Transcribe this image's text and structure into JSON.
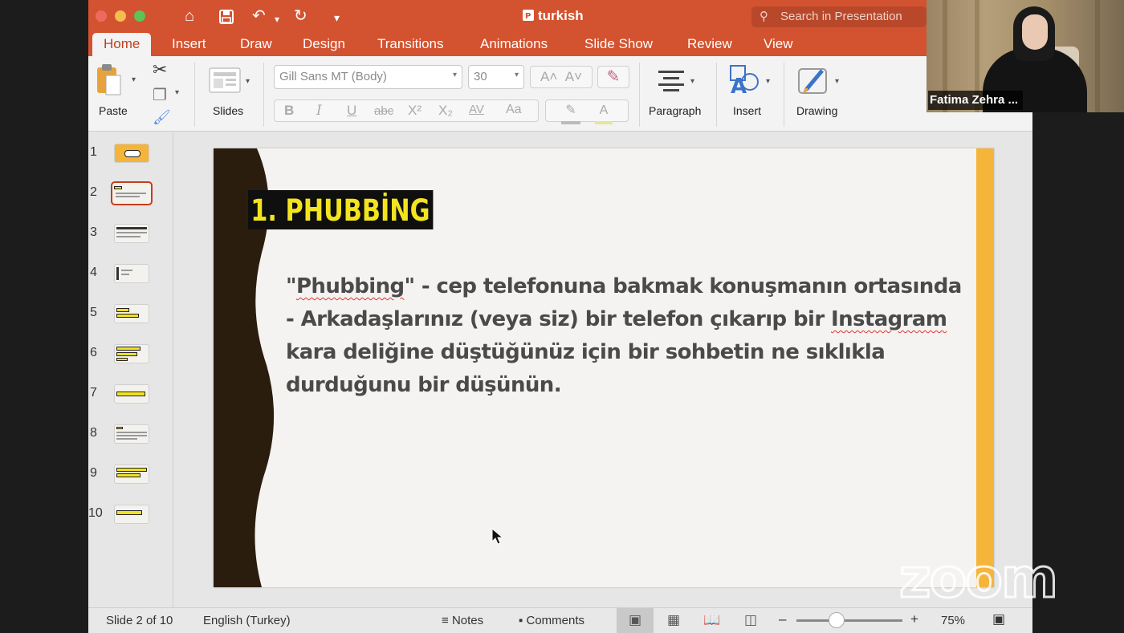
{
  "window": {
    "title": "turkish",
    "search_placeholder": "Search in Presentation"
  },
  "tabs": [
    {
      "label": "Home",
      "active": true
    },
    {
      "label": "Insert"
    },
    {
      "label": "Draw"
    },
    {
      "label": "Design"
    },
    {
      "label": "Transitions"
    },
    {
      "label": "Animations"
    },
    {
      "label": "Slide Show"
    },
    {
      "label": "Review"
    },
    {
      "label": "View"
    }
  ],
  "ribbon": {
    "paste_label": "Paste",
    "slides_label": "Slides",
    "font_name": "Gill Sans MT (Body)",
    "font_size": "30",
    "paragraph_label": "Paragraph",
    "insert_label": "Insert",
    "drawing_label": "Drawing",
    "grow_font": "A˄",
    "shrink_font": "A˅",
    "bold": "B",
    "italic": "I",
    "underline": "U",
    "strike": "abc",
    "superscript": "X²",
    "subscript": "X₂",
    "spacing": "AV",
    "change_case": "Aa"
  },
  "thumbnails": [
    "1",
    "2",
    "3",
    "4",
    "5",
    "6",
    "7",
    "8",
    "9",
    "10"
  ],
  "selected_slide": 2,
  "slide": {
    "title": "1. PHUBBİNG",
    "body_parts": {
      "q1": "\"",
      "w1": "Phubbing",
      "t1": "\" - cep telefonuna bakmak konuşmanın ortasında - Arkadaşlarınız (veya siz) bir telefon çıkarıp bir ",
      "w2": "Instagram",
      "t2": " kara deliğine düştüğünüz için bir sohbetin ne sıklıkla durduğunu bir düşünün."
    }
  },
  "status": {
    "slide_info": "Slide 2 of 10",
    "language": "English (Turkey)",
    "notes": "Notes",
    "comments": "Comments",
    "zoom": "75%"
  },
  "video": {
    "participant": "Fatima Zehra ..."
  },
  "overlay": {
    "logo": "zoom"
  },
  "colors": {
    "accent": "#d35230",
    "slide_title_bg": "#0f0f0f",
    "slide_title_fg": "#f2e41f",
    "stripe": "#f5b43a",
    "wave": "#2b1d0e"
  }
}
